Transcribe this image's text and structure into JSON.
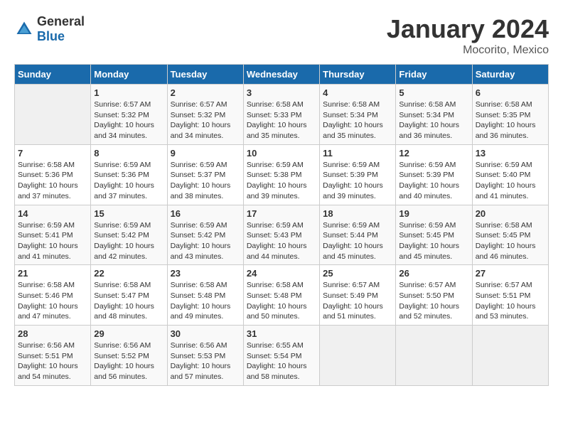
{
  "header": {
    "logo_general": "General",
    "logo_blue": "Blue",
    "month": "January 2024",
    "location": "Mocorito, Mexico"
  },
  "days_of_week": [
    "Sunday",
    "Monday",
    "Tuesday",
    "Wednesday",
    "Thursday",
    "Friday",
    "Saturday"
  ],
  "weeks": [
    [
      {
        "day": "",
        "info": ""
      },
      {
        "day": "1",
        "info": "Sunrise: 6:57 AM\nSunset: 5:32 PM\nDaylight: 10 hours\nand 34 minutes."
      },
      {
        "day": "2",
        "info": "Sunrise: 6:57 AM\nSunset: 5:32 PM\nDaylight: 10 hours\nand 34 minutes."
      },
      {
        "day": "3",
        "info": "Sunrise: 6:58 AM\nSunset: 5:33 PM\nDaylight: 10 hours\nand 35 minutes."
      },
      {
        "day": "4",
        "info": "Sunrise: 6:58 AM\nSunset: 5:34 PM\nDaylight: 10 hours\nand 35 minutes."
      },
      {
        "day": "5",
        "info": "Sunrise: 6:58 AM\nSunset: 5:34 PM\nDaylight: 10 hours\nand 36 minutes."
      },
      {
        "day": "6",
        "info": "Sunrise: 6:58 AM\nSunset: 5:35 PM\nDaylight: 10 hours\nand 36 minutes."
      }
    ],
    [
      {
        "day": "7",
        "info": "Sunrise: 6:58 AM\nSunset: 5:36 PM\nDaylight: 10 hours\nand 37 minutes."
      },
      {
        "day": "8",
        "info": "Sunrise: 6:59 AM\nSunset: 5:36 PM\nDaylight: 10 hours\nand 37 minutes."
      },
      {
        "day": "9",
        "info": "Sunrise: 6:59 AM\nSunset: 5:37 PM\nDaylight: 10 hours\nand 38 minutes."
      },
      {
        "day": "10",
        "info": "Sunrise: 6:59 AM\nSunset: 5:38 PM\nDaylight: 10 hours\nand 39 minutes."
      },
      {
        "day": "11",
        "info": "Sunrise: 6:59 AM\nSunset: 5:39 PM\nDaylight: 10 hours\nand 39 minutes."
      },
      {
        "day": "12",
        "info": "Sunrise: 6:59 AM\nSunset: 5:39 PM\nDaylight: 10 hours\nand 40 minutes."
      },
      {
        "day": "13",
        "info": "Sunrise: 6:59 AM\nSunset: 5:40 PM\nDaylight: 10 hours\nand 41 minutes."
      }
    ],
    [
      {
        "day": "14",
        "info": "Sunrise: 6:59 AM\nSunset: 5:41 PM\nDaylight: 10 hours\nand 41 minutes."
      },
      {
        "day": "15",
        "info": "Sunrise: 6:59 AM\nSunset: 5:42 PM\nDaylight: 10 hours\nand 42 minutes."
      },
      {
        "day": "16",
        "info": "Sunrise: 6:59 AM\nSunset: 5:42 PM\nDaylight: 10 hours\nand 43 minutes."
      },
      {
        "day": "17",
        "info": "Sunrise: 6:59 AM\nSunset: 5:43 PM\nDaylight: 10 hours\nand 44 minutes."
      },
      {
        "day": "18",
        "info": "Sunrise: 6:59 AM\nSunset: 5:44 PM\nDaylight: 10 hours\nand 45 minutes."
      },
      {
        "day": "19",
        "info": "Sunrise: 6:59 AM\nSunset: 5:45 PM\nDaylight: 10 hours\nand 45 minutes."
      },
      {
        "day": "20",
        "info": "Sunrise: 6:58 AM\nSunset: 5:45 PM\nDaylight: 10 hours\nand 46 minutes."
      }
    ],
    [
      {
        "day": "21",
        "info": "Sunrise: 6:58 AM\nSunset: 5:46 PM\nDaylight: 10 hours\nand 47 minutes."
      },
      {
        "day": "22",
        "info": "Sunrise: 6:58 AM\nSunset: 5:47 PM\nDaylight: 10 hours\nand 48 minutes."
      },
      {
        "day": "23",
        "info": "Sunrise: 6:58 AM\nSunset: 5:48 PM\nDaylight: 10 hours\nand 49 minutes."
      },
      {
        "day": "24",
        "info": "Sunrise: 6:58 AM\nSunset: 5:48 PM\nDaylight: 10 hours\nand 50 minutes."
      },
      {
        "day": "25",
        "info": "Sunrise: 6:57 AM\nSunset: 5:49 PM\nDaylight: 10 hours\nand 51 minutes."
      },
      {
        "day": "26",
        "info": "Sunrise: 6:57 AM\nSunset: 5:50 PM\nDaylight: 10 hours\nand 52 minutes."
      },
      {
        "day": "27",
        "info": "Sunrise: 6:57 AM\nSunset: 5:51 PM\nDaylight: 10 hours\nand 53 minutes."
      }
    ],
    [
      {
        "day": "28",
        "info": "Sunrise: 6:56 AM\nSunset: 5:51 PM\nDaylight: 10 hours\nand 54 minutes."
      },
      {
        "day": "29",
        "info": "Sunrise: 6:56 AM\nSunset: 5:52 PM\nDaylight: 10 hours\nand 56 minutes."
      },
      {
        "day": "30",
        "info": "Sunrise: 6:56 AM\nSunset: 5:53 PM\nDaylight: 10 hours\nand 57 minutes."
      },
      {
        "day": "31",
        "info": "Sunrise: 6:55 AM\nSunset: 5:54 PM\nDaylight: 10 hours\nand 58 minutes."
      },
      {
        "day": "",
        "info": ""
      },
      {
        "day": "",
        "info": ""
      },
      {
        "day": "",
        "info": ""
      }
    ]
  ]
}
